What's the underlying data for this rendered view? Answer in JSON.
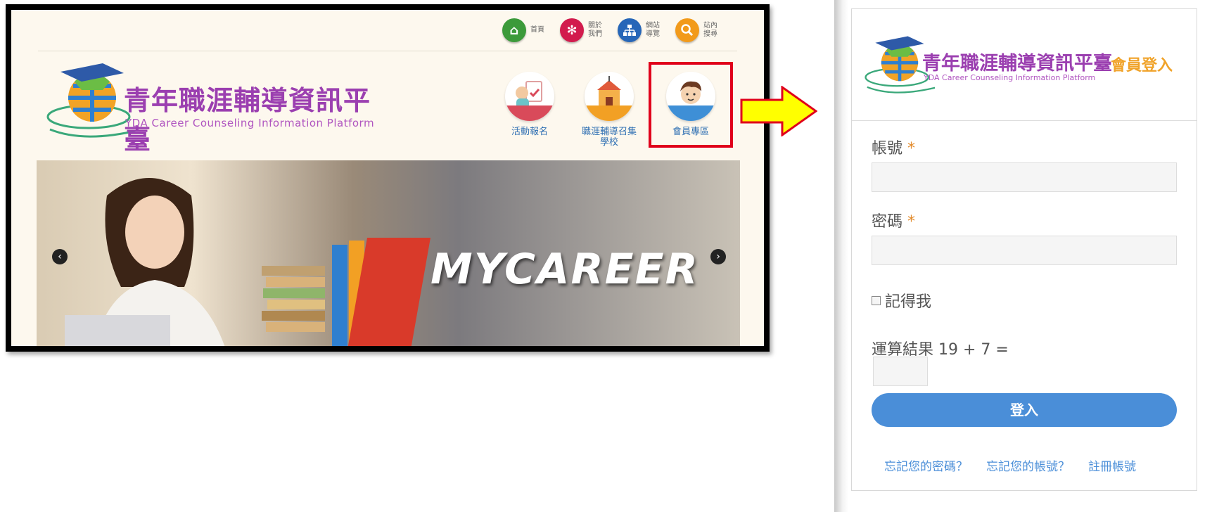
{
  "site": {
    "topnav": [
      {
        "label": "首頁",
        "color": "#3c9a3a",
        "glyph": "⌂"
      },
      {
        "label": "關於我們",
        "color": "#d21b4d",
        "glyph": "✻"
      },
      {
        "label": "網站導覽",
        "color": "#2666b8",
        "glyph": "⚲"
      },
      {
        "label": "站內搜尋",
        "color": "#f29a1a",
        "glyph": "⚲"
      }
    ],
    "logo_title": "青年職涯輔導資訊平臺",
    "logo_subtitle": "YDA Career Counseling Information Platform",
    "features": [
      {
        "label": "活動報名",
        "arc": "#d94a5a"
      },
      {
        "label": "職涯輔導召集學校",
        "arc": "#f2a024"
      },
      {
        "label": "會員專區",
        "arc": "#3e8fd6"
      }
    ],
    "banner_text": "MYCAREER",
    "prev_arrow": "‹",
    "next_arrow": "›"
  },
  "login": {
    "logo_title": "青年職涯輔導資訊平臺",
    "logo_subtitle": "YDA Career Counseling Information Platform",
    "heading": "會員登入",
    "account_label": "帳號",
    "password_label": "密碼",
    "required_mark": "*",
    "remember_label": "記得我",
    "captcha_label": "運算結果 19 + 7 =",
    "submit_label": "登入",
    "links": [
      "忘記您的密碼？",
      "忘記您的帳號？",
      "註冊帳號"
    ]
  },
  "colors": {
    "highlight": "#e0001b",
    "arrow": "#ffff00",
    "brand_purple": "#9b3fb0",
    "button_blue": "#4a8ed8"
  }
}
